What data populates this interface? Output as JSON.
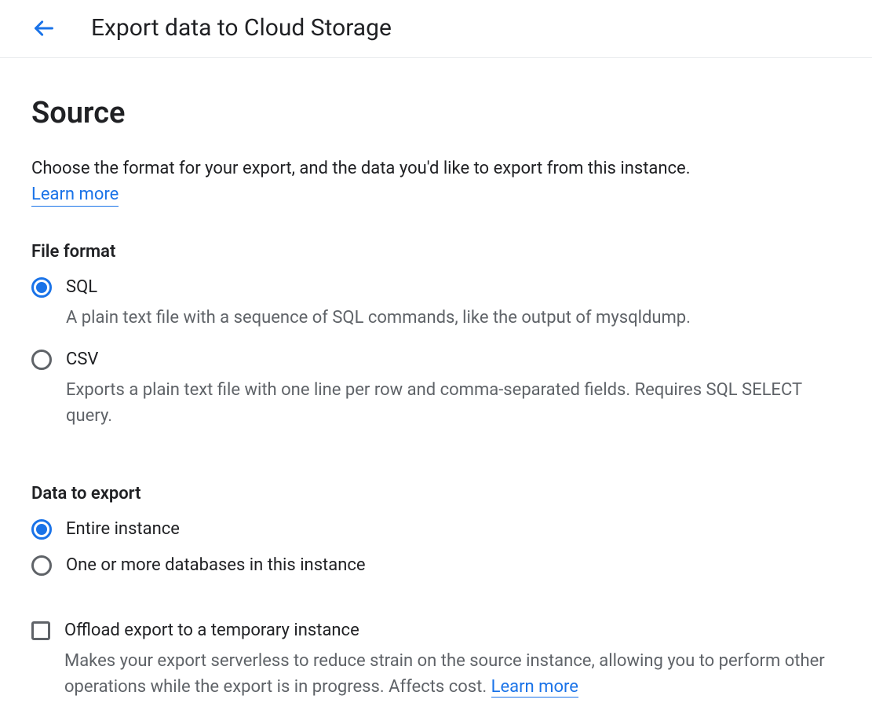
{
  "header": {
    "title": "Export data to Cloud Storage"
  },
  "source": {
    "title": "Source",
    "description": "Choose the format for your export, and the data you'd like to export from this instance.",
    "learn_more": "Learn more"
  },
  "file_format": {
    "title": "File format",
    "options": [
      {
        "label": "SQL",
        "description": "A plain text file with a sequence of SQL commands, like the output of mysqldump.",
        "selected": true
      },
      {
        "label": "CSV",
        "description": "Exports a plain text file with one line per row and comma-separated fields. Requires SQL SELECT query.",
        "selected": false
      }
    ]
  },
  "data_to_export": {
    "title": "Data to export",
    "options": [
      {
        "label": "Entire instance",
        "selected": true
      },
      {
        "label": "One or more databases in this instance",
        "selected": false
      }
    ]
  },
  "offload": {
    "label": "Offload export to a temporary instance",
    "description": "Makes your export serverless to reduce strain on the source instance, allowing you to perform other operations while the export is in progress. Affects cost. ",
    "learn_more": "Learn more",
    "checked": false
  }
}
